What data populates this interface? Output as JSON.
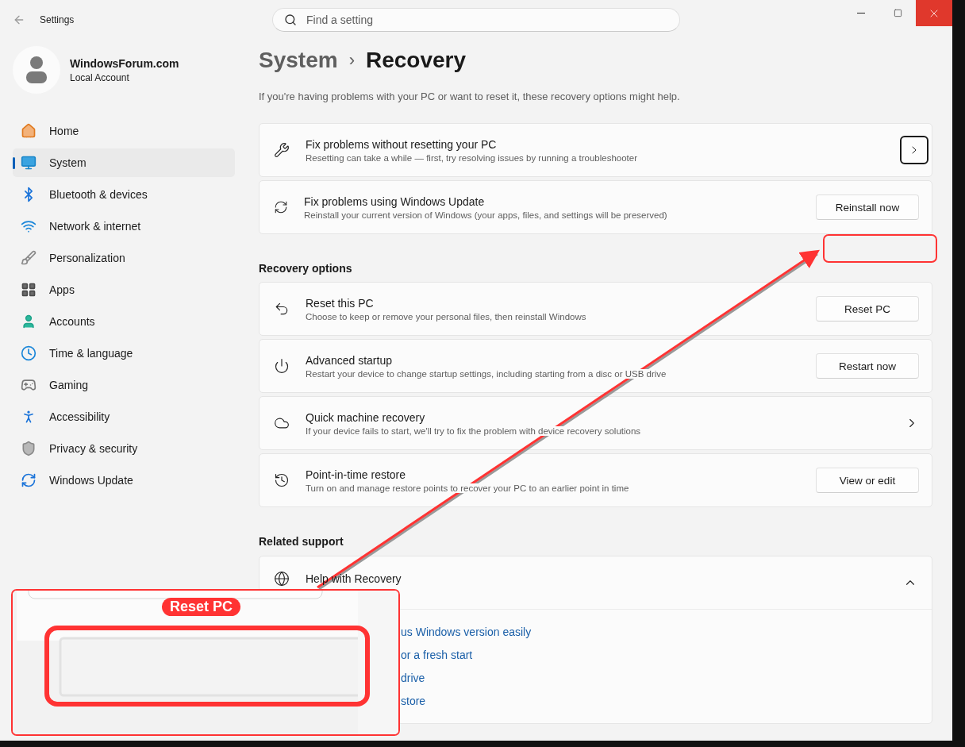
{
  "window": {
    "title": "Settings"
  },
  "search": {
    "placeholder": "Find a setting"
  },
  "account": {
    "name": "WindowsForum.com",
    "type": "Local Account"
  },
  "nav": [
    {
      "label": "Home",
      "selected": false
    },
    {
      "label": "System",
      "selected": true
    },
    {
      "label": "Bluetooth & devices",
      "selected": false
    },
    {
      "label": "Network & internet",
      "selected": false
    },
    {
      "label": "Personalization",
      "selected": false
    },
    {
      "label": "Apps",
      "selected": false
    },
    {
      "label": "Accounts",
      "selected": false
    },
    {
      "label": "Time & language",
      "selected": false
    },
    {
      "label": "Gaming",
      "selected": false
    },
    {
      "label": "Accessibility",
      "selected": false
    },
    {
      "label": "Privacy & security",
      "selected": false
    },
    {
      "label": "Windows Update",
      "selected": false
    }
  ],
  "breadcrumb": {
    "parent": "System",
    "separator": "›",
    "current": "Recovery"
  },
  "intro": "If you're having problems with your PC or want to reset it, these recovery options might help.",
  "top_cards": [
    {
      "title": "Fix problems without resetting your PC",
      "subtitle": "Resetting can take a while — first, try resolving issues by running a troubleshooter",
      "kind": "chevron-button"
    },
    {
      "title": "Fix problems using Windows Update",
      "subtitle": "Reinstall your current version of Windows (your apps, files, and settings will be preserved)",
      "kind": "button",
      "button": "Reinstall now"
    }
  ],
  "recovery_options": {
    "heading": "Recovery options",
    "cards": [
      {
        "title": "Reset this PC",
        "subtitle": "Choose to keep or remove your personal files, then reinstall Windows",
        "kind": "button",
        "button": "Reset PC"
      },
      {
        "title": "Advanced startup",
        "subtitle": "Restart your device to change startup settings, including starting from a disc or USB drive",
        "kind": "button",
        "button": "Restart now"
      },
      {
        "title": "Quick machine recovery",
        "subtitle": "If your device fails to start, we'll try to fix the problem with device recovery solutions",
        "kind": "chevron"
      },
      {
        "title": "Point-in-time restore",
        "subtitle": "Turn on and manage restore points to recover your PC to an earlier point in time",
        "kind": "button",
        "button": "View or edit"
      }
    ]
  },
  "related_support": {
    "heading": "Related support",
    "title": "Help with Recovery",
    "expanded": true,
    "links": [
      "us Windows version easily",
      "or a fresh start",
      "drive",
      "store"
    ]
  },
  "annotation": {
    "label": "Reset PC"
  }
}
